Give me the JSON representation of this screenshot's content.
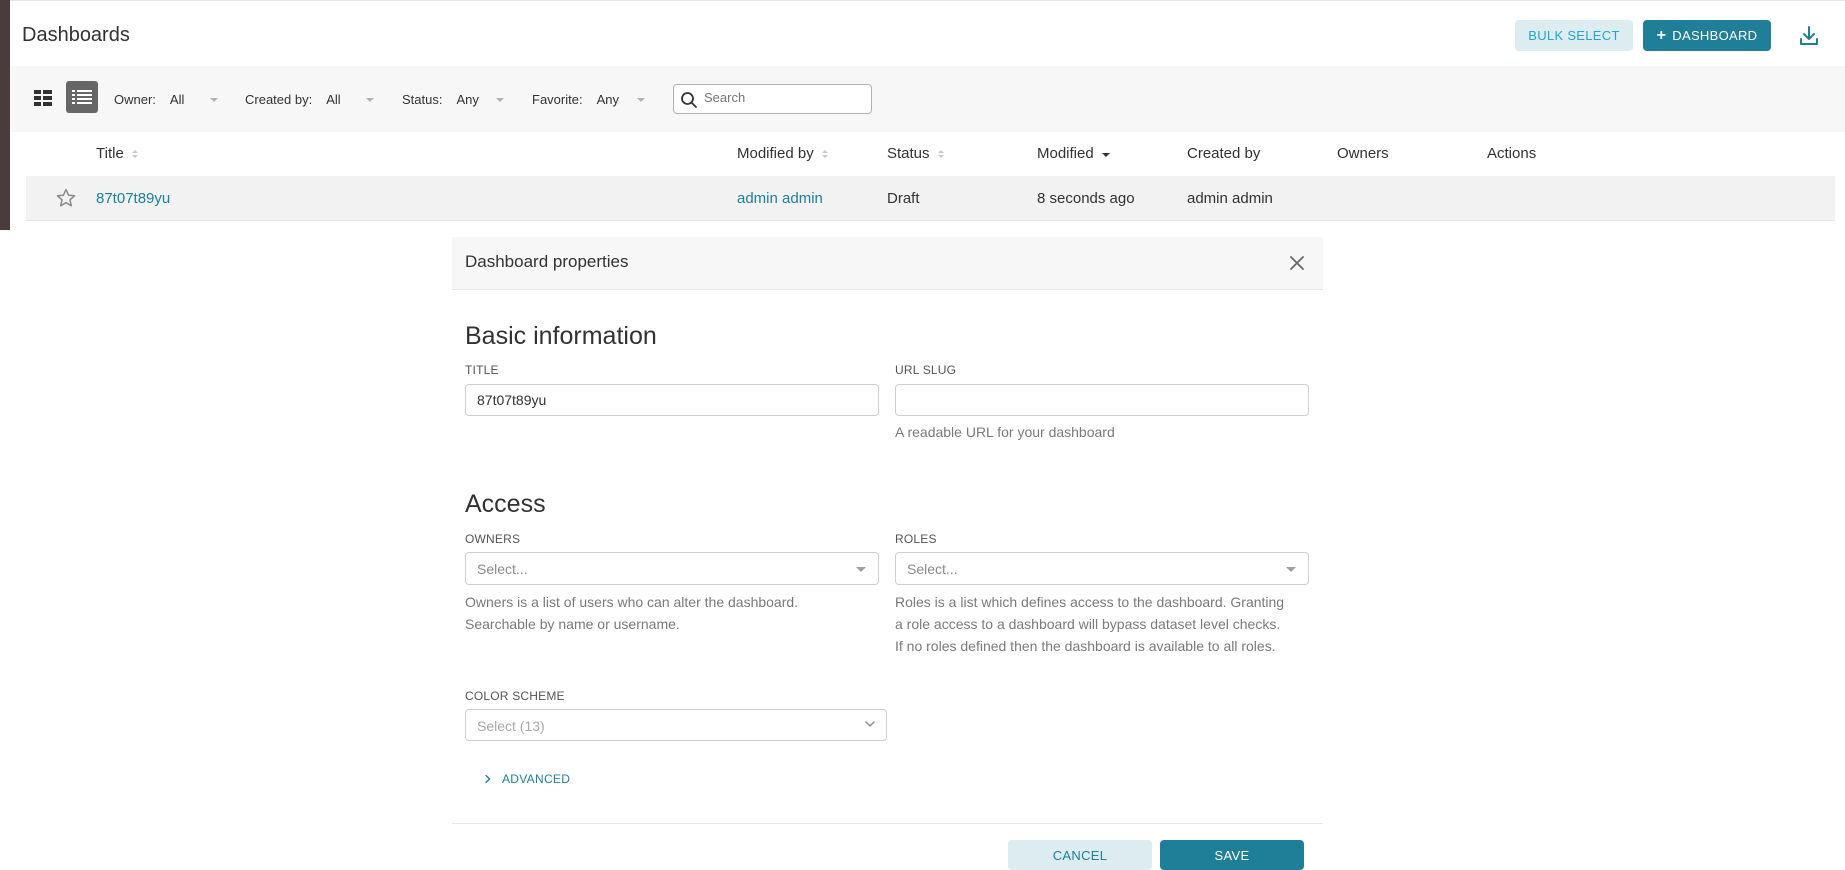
{
  "header": {
    "title": "Dashboards",
    "bulk_select_label": "BULK SELECT",
    "add_dashboard_label": "DASHBOARD",
    "add_dashboard_icon": "plus-icon",
    "download_icon": "download-icon"
  },
  "filters": {
    "owner": {
      "label": "Owner:",
      "value": "All"
    },
    "created_by": {
      "label": "Created by:",
      "value": "All"
    },
    "status": {
      "label": "Status:",
      "value": "Any"
    },
    "favorite": {
      "label": "Favorite:",
      "value": "Any"
    },
    "search_placeholder": "Search"
  },
  "table": {
    "columns": [
      "Title",
      "Modified by",
      "Status",
      "Modified",
      "Created by",
      "Owners",
      "Actions"
    ],
    "rows": [
      {
        "title": "87t07t89yu",
        "modified_by": "admin admin",
        "status": "Draft",
        "modified": "8 seconds ago",
        "created_by": "admin admin",
        "owners": "",
        "actions": ""
      }
    ]
  },
  "modal": {
    "title": "Dashboard properties",
    "basic_info_heading": "Basic information",
    "title_label": "TITLE",
    "title_value": "87t07t89yu",
    "url_slug_label": "URL SLUG",
    "url_slug_value": "",
    "url_slug_help": "A readable URL for your dashboard",
    "access_heading": "Access",
    "owners_label": "OWNERS",
    "owners_placeholder": "Select...",
    "owners_help_1": "Owners is a list of users who can alter the dashboard.",
    "owners_help_2": "Searchable by name or username.",
    "roles_label": "ROLES",
    "roles_placeholder": "Select...",
    "roles_help_1": "Roles is a list which defines access to the dashboard. Granting",
    "roles_help_2": "a role access to a dashboard will bypass dataset level checks.",
    "roles_help_3": "If no roles defined then the dashboard is available to all roles.",
    "color_scheme_label": "COLOR SCHEME",
    "color_scheme_placeholder": "Select (13)",
    "advanced_label": "ADVANCED",
    "cancel_label": "CANCEL",
    "save_label": "SAVE"
  },
  "colors": {
    "primary": "#1f7f99",
    "primary_light": "#dcecf1",
    "text": "#323232",
    "muted": "#7a7a7a"
  }
}
